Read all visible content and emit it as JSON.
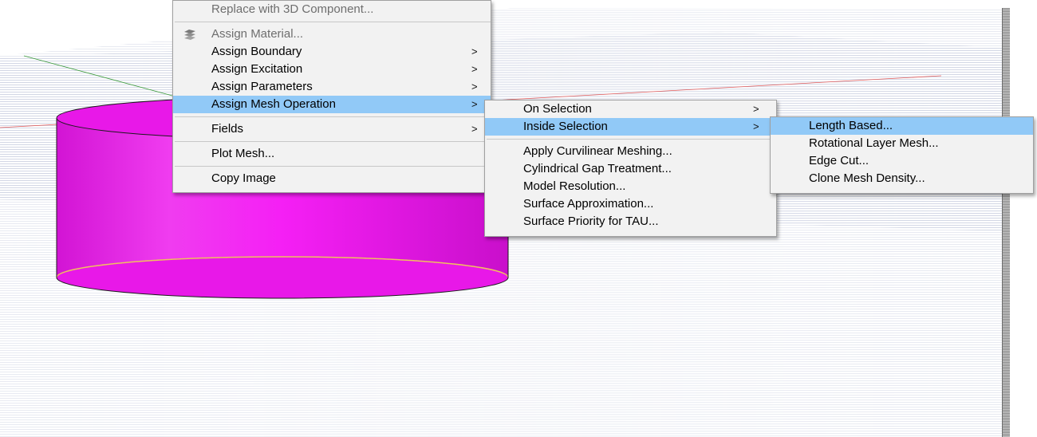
{
  "viewport": {
    "object_color": "#e815e8",
    "background_color": "#ffffff"
  },
  "context_menu": {
    "items": [
      {
        "label": "Replace with 3D Component...",
        "disabled": true
      },
      {
        "label": "Assign Material...",
        "disabled": true,
        "icon": "material-icon"
      },
      {
        "label": "Assign Boundary",
        "arrow": ">"
      },
      {
        "label": "Assign Excitation",
        "arrow": ">"
      },
      {
        "label": "Assign Parameters",
        "arrow": ">"
      },
      {
        "label": "Assign Mesh Operation",
        "arrow": ">",
        "highlighted": true
      },
      {
        "label": "Fields",
        "arrow": ">"
      },
      {
        "label": "Plot Mesh..."
      },
      {
        "label": "Copy Image"
      }
    ]
  },
  "mesh_operation_menu": {
    "items": [
      {
        "label": "On Selection",
        "arrow": ">"
      },
      {
        "label": "Inside Selection",
        "arrow": ">",
        "highlighted": true
      },
      {
        "label": "Apply Curvilinear Meshing..."
      },
      {
        "label": "Cylindrical Gap Treatment..."
      },
      {
        "label": "Model Resolution..."
      },
      {
        "label": "Surface Approximation..."
      },
      {
        "label": "Surface Priority for TAU..."
      }
    ]
  },
  "inside_selection_menu": {
    "items": [
      {
        "label": "Length Based...",
        "highlighted": true
      },
      {
        "label": "Rotational Layer Mesh..."
      },
      {
        "label": "Edge Cut..."
      },
      {
        "label": "Clone Mesh Density..."
      }
    ]
  },
  "colors": {
    "menu_highlight": "#91c9f7",
    "menu_background": "#f2f2f2"
  }
}
